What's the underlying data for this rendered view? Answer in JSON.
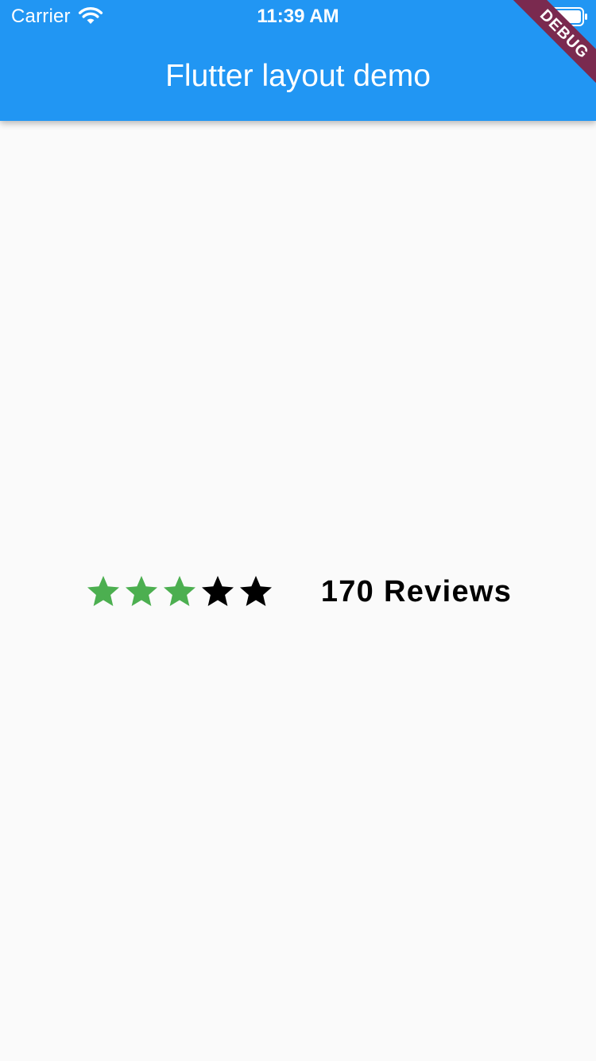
{
  "status_bar": {
    "carrier": "Carrier",
    "time": "11:39 AM",
    "wifi_icon": "wifi-icon",
    "battery_icon": "battery-icon"
  },
  "app_bar": {
    "title": "Flutter layout demo",
    "background_color": "#2196F3"
  },
  "debug_banner": {
    "label": "DEBUG",
    "color": "#7A2A4F"
  },
  "rating": {
    "filled_stars": 3,
    "total_stars": 5,
    "filled_color": "#4CAF50",
    "empty_color": "#000000",
    "reviews_text": "170 Reviews"
  }
}
